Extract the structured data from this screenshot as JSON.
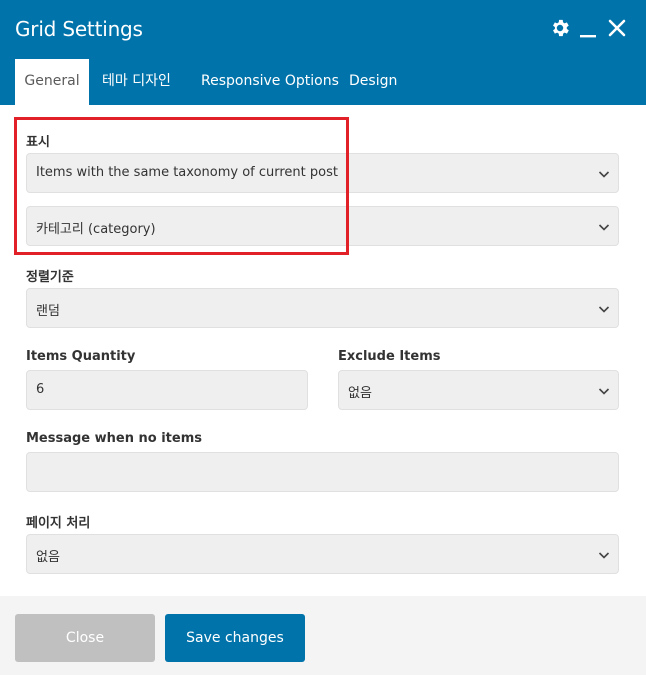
{
  "header": {
    "title": "Grid Settings",
    "icons": [
      "gear-icon",
      "minimize-icon",
      "close-icon"
    ]
  },
  "tabs": [
    {
      "label": "General",
      "active": true
    },
    {
      "label": "테마 디자인",
      "active": false
    },
    {
      "label": "Responsive Options",
      "active": false
    },
    {
      "label": "Design",
      "active": false
    }
  ],
  "form": {
    "display": {
      "label": "표시",
      "value": "Items with the same taxonomy of current post",
      "taxonomy_value": "카테고리 (category)"
    },
    "sort": {
      "label": "정렬기준",
      "value": "랜덤"
    },
    "items_quantity": {
      "label": "Items Quantity",
      "value": "6"
    },
    "exclude_items": {
      "label": "Exclude Items",
      "value": "없음"
    },
    "message_no_items": {
      "label": "Message when no items",
      "value": ""
    },
    "pagination": {
      "label": "페이지 처리",
      "value": "없음"
    }
  },
  "footer": {
    "close_label": "Close",
    "save_label": "Save changes"
  },
  "colors": {
    "accent": "#0073aa",
    "highlight": "#e22028",
    "field_bg": "#efefef",
    "close_button": "#c0c0c0"
  }
}
